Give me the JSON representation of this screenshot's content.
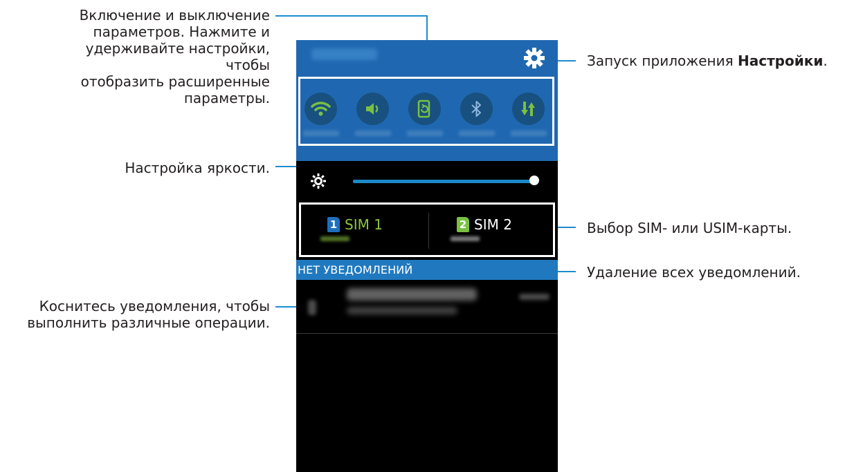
{
  "callouts": {
    "toggle_desc": [
      "Включение и выключение",
      "параметров. Нажмите и",
      "удерживайте настройки, чтобы",
      "отобразить расширенные",
      "параметры."
    ],
    "brightness_desc": "Настройка яркости.",
    "notification_desc": [
      "Коснитесь уведомления, чтобы",
      "выполнить различные операции."
    ],
    "settings_prefix": "Запуск приложения ",
    "settings_bold": "Настройки",
    "settings_suffix": ".",
    "sim_desc": "Выбор SIM- или USIM-карты.",
    "clear_desc": "Удаление всех уведомлений."
  },
  "phone": {
    "settings_icon": "gear-icon",
    "toggles": [
      {
        "name": "wifi-icon",
        "color": "#7ac143"
      },
      {
        "name": "sound-icon",
        "color": "#7ac143"
      },
      {
        "name": "rotation-icon",
        "color": "#7ac143"
      },
      {
        "name": "bluetooth-icon",
        "color": "#8fb7df"
      },
      {
        "name": "data-icon",
        "color": "#7ac143"
      }
    ],
    "brightness_icon": "sun-icon",
    "brightness_level": 0.97,
    "sims": [
      {
        "badge": "1",
        "label": "SIM 1",
        "badge_color": "#1f6fbd",
        "label_color": "#8dc63f"
      },
      {
        "badge": "2",
        "label": "SIM 2",
        "badge_color": "#7ac143",
        "label_color": "#ffffff"
      }
    ],
    "notifications_header": "НЕТ УВЕДОМЛЕНИЙ"
  },
  "colors": {
    "accent": "#1c8ccf",
    "panel_blue": "#1f68b1",
    "toggle_bg": "#18507f"
  }
}
